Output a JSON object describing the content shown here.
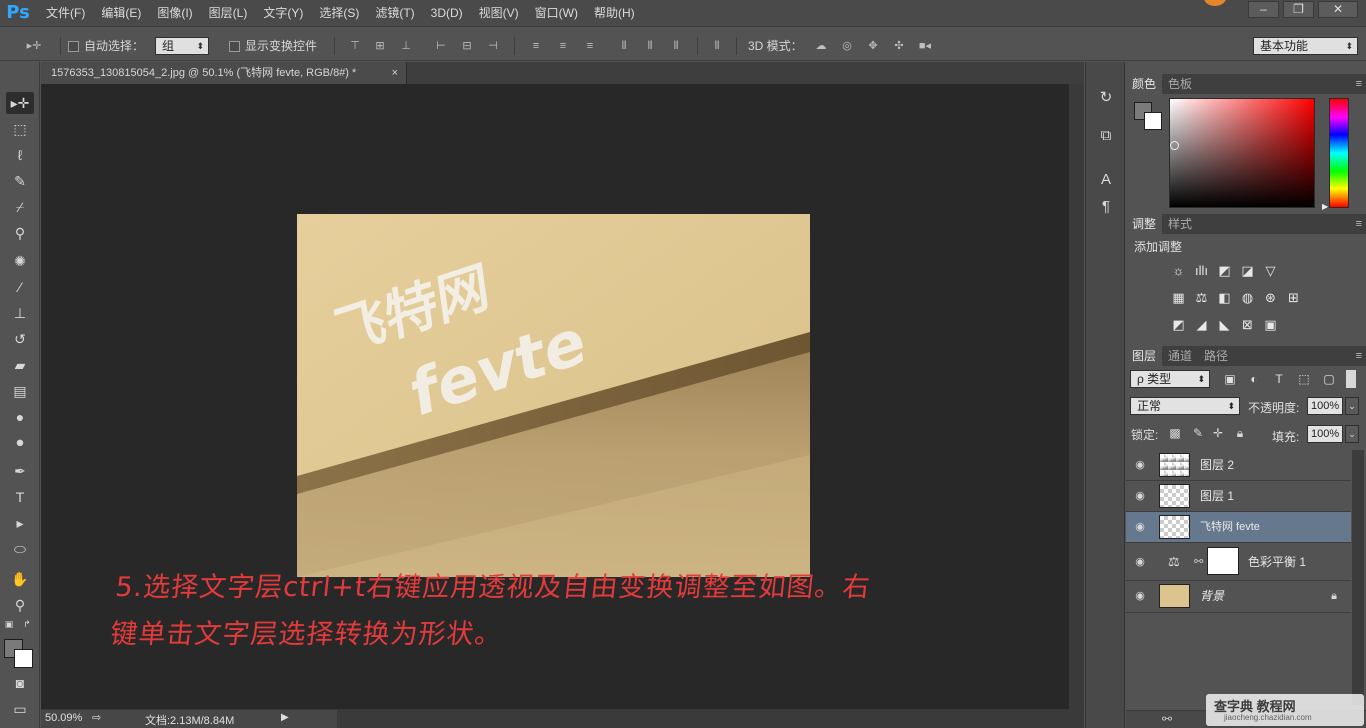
{
  "app": {
    "logo": "Ps"
  },
  "menu": [
    "文件(F)",
    "编辑(E)",
    "图像(I)",
    "图层(L)",
    "文字(Y)",
    "选择(S)",
    "滤镜(T)",
    "3D(D)",
    "视图(V)",
    "窗口(W)",
    "帮助(H)"
  ],
  "window_controls": {
    "minimize": "–",
    "restore": "❐",
    "close": "✕"
  },
  "options": {
    "auto_select_label": "自动选择：",
    "auto_select_value": "组",
    "show_transform_label": "显示变换控件",
    "mode_3d_label": "3D 模式：",
    "workspace": "基本功能"
  },
  "document": {
    "tab_title": "1576353_130815054_2.jpg @ 50.1% (飞特网 fevte, RGB/8#) *",
    "close": "×"
  },
  "photo": {
    "text_cn": "飞特网",
    "text_en": "fevte"
  },
  "note": {
    "line1": "5.选择文字层ctrl+t右键应用透视及自由变换调整至如图。右",
    "line2": "键单击文字层选择转换为形状。"
  },
  "status": {
    "zoom": "50.09%",
    "doc_info": "文档:2.13M/8.84M"
  },
  "panels": {
    "color_tabs": [
      "颜色",
      "色板"
    ],
    "adjust_tabs": [
      "调整",
      "样式"
    ],
    "adjust_title": "添加调整",
    "layers_tabs": [
      "图层",
      "通道",
      "路径"
    ],
    "filter_kind": "ρ 类型",
    "blend_mode": "正常",
    "opacity_label": "不透明度:",
    "opacity_value": "100%",
    "lock_label": "锁定:",
    "fill_label": "填充:",
    "fill_value": "100%"
  },
  "layers": [
    {
      "name": "图层 2",
      "selected": false
    },
    {
      "name": "图层 1",
      "selected": false
    },
    {
      "name": "飞特网 fevte",
      "selected": true
    },
    {
      "name": "色彩平衡 1",
      "selected": false
    },
    {
      "name": "背景",
      "selected": false,
      "locked": true
    }
  ],
  "watermark": {
    "line1": "查字典 教程网",
    "line2": "jiaocheng.chazidian.com"
  },
  "colors": {
    "accent": "#31a8ff",
    "note_red": "#e33b3b",
    "selected_layer": "#65788d",
    "canvas_bg": "#282828"
  }
}
